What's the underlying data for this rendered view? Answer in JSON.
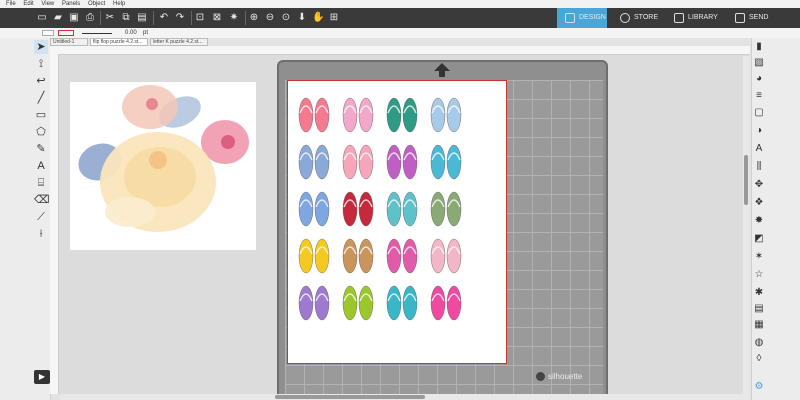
{
  "menu": [
    "File",
    "Edit",
    "View",
    "Panels",
    "Object",
    "Help"
  ],
  "nav_tabs": [
    "DESIGN",
    "STORE",
    "LIBRARY",
    "SEND"
  ],
  "colors": {
    "accent": "#4aa6d8",
    "toolbar_bg": "#3a3a3a",
    "cut_border": "#cc3333"
  },
  "propbar": {
    "line_value": "0.00",
    "line_unit": "pt"
  },
  "doc_tabs": [
    "Untitled-1",
    "flip flop puzzle 4.2.st...",
    "letter K puzzle 4.2.st..."
  ],
  "brand": "silhouette",
  "flipflops": [
    [
      "#f47a8f",
      "#f3a7c9",
      "#2f9a86",
      "#a9c9e8"
    ],
    [
      "#8aa9d9",
      "#f6a6b8",
      "#c05fc3",
      "#4bb8d6"
    ],
    [
      "#7ea6e0",
      "#c8283c",
      "#5fc2c9",
      "#8ba877"
    ],
    [
      "#f4c920",
      "#c9955a",
      "#e15ca8",
      "#f3b6c8"
    ],
    [
      "#9d79cf",
      "#9bc72d",
      "#39b7c8",
      "#ef4aa0"
    ]
  ]
}
